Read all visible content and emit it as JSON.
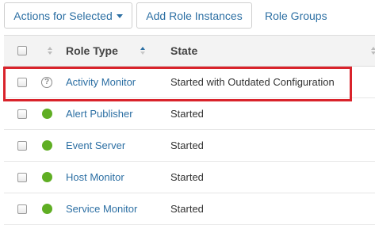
{
  "toolbar": {
    "actions_label": "Actions for Selected",
    "add_label": "Add Role Instances",
    "groups_label": "Role Groups"
  },
  "table": {
    "headers": {
      "role_type": "Role Type",
      "state": "State"
    },
    "rows": [
      {
        "role": "Activity Monitor",
        "state": "Started with Outdated Configuration",
        "status_icon": "question-icon"
      },
      {
        "role": "Alert Publisher",
        "state": "Started",
        "status_icon": "status-green-icon"
      },
      {
        "role": "Event Server",
        "state": "Started",
        "status_icon": "status-green-icon"
      },
      {
        "role": "Host Monitor",
        "state": "Started",
        "status_icon": "status-green-icon"
      },
      {
        "role": "Service Monitor",
        "state": "Started",
        "status_icon": "status-green-icon"
      }
    ]
  },
  "colors": {
    "link": "#2c6fa3",
    "status_green": "#5fae23",
    "highlight": "#d9232b"
  }
}
